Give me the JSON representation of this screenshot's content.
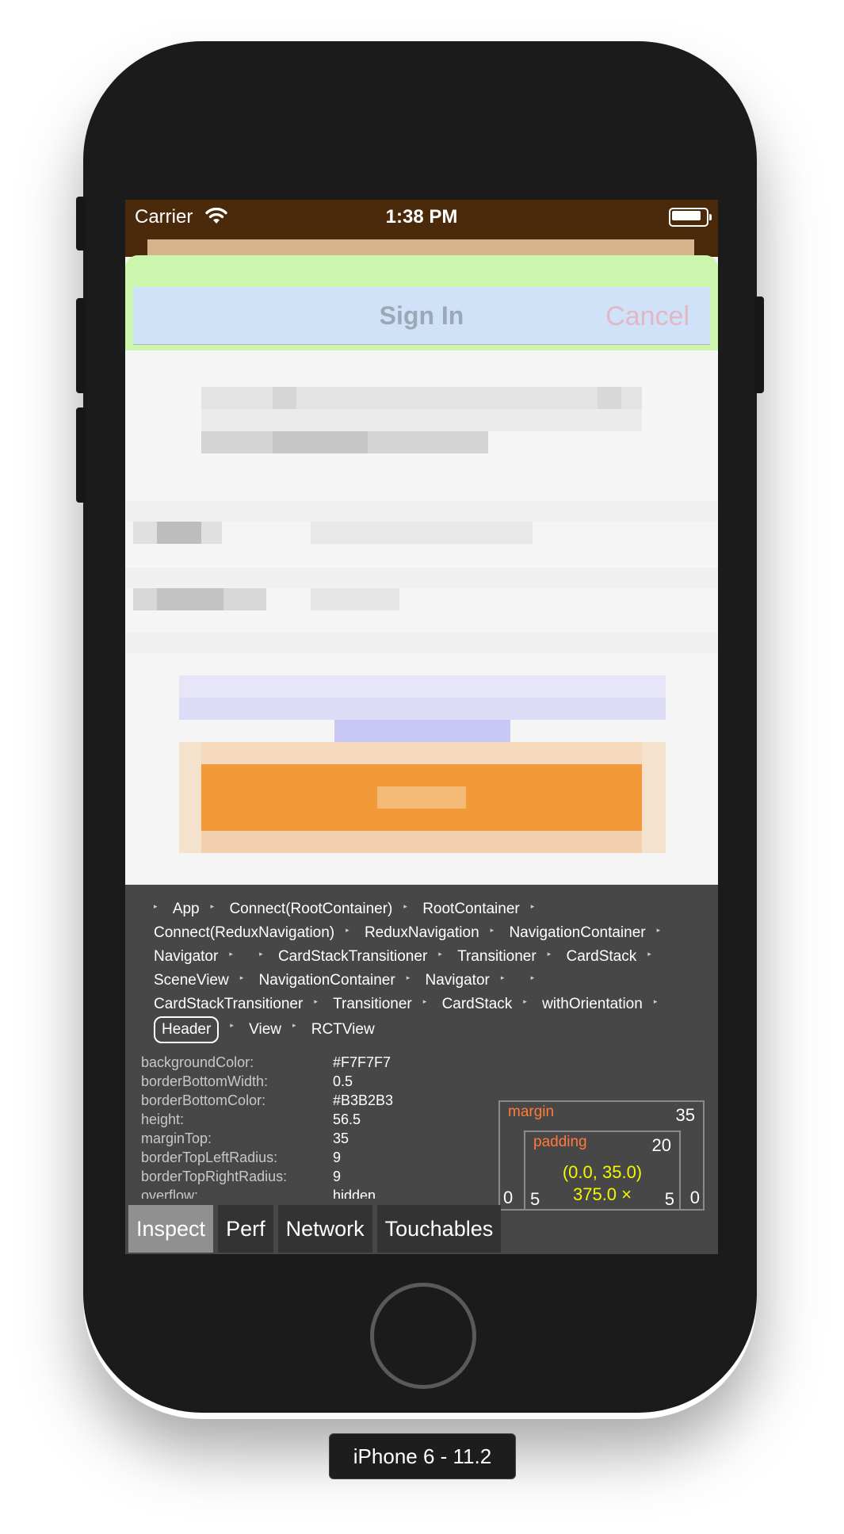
{
  "status_bar": {
    "carrier": "Carrier",
    "time": "1:38 PM"
  },
  "header": {
    "title": "Sign In",
    "cancel_label": "Cancel",
    "background_color": "#D0E2F8"
  },
  "colors": {
    "orange_button": "#F29A39",
    "inspector_bg": "#474747",
    "status_bar_bg": "#4A2A0B",
    "margin_highlight": "#CCF5AD"
  },
  "inspector": {
    "breadcrumbs": [
      "App",
      "Connect(RootContainer)",
      "RootContainer",
      "Connect(ReduxNavigation)",
      "ReduxNavigation",
      "NavigationContainer",
      "Navigator",
      "",
      "CardStackTransitioner",
      "Transitioner",
      "CardStack",
      "SceneView",
      "NavigationContainer",
      "Navigator",
      "",
      "CardStackTransitioner",
      "Transitioner",
      "CardStack",
      "withOrientation",
      "Header",
      "View",
      "RCTView"
    ],
    "selected_crumb": "Header",
    "props": [
      {
        "name": "backgroundColor:",
        "value": "#F7F7F7"
      },
      {
        "name": "borderBottomWidth:",
        "value": "0.5"
      },
      {
        "name": "borderBottomColor:",
        "value": "#B3B2B3"
      },
      {
        "name": "height:",
        "value": "56.5"
      },
      {
        "name": "marginTop:",
        "value": "35"
      },
      {
        "name": "borderTopLeftRadius:",
        "value": "9"
      },
      {
        "name": "borderTopRightRadius:",
        "value": "9"
      },
      {
        "name": "overflow:",
        "value": "hidden"
      }
    ],
    "box_model": {
      "margin_label": "margin",
      "margin_top": "35",
      "padding_label": "padding",
      "padding_top": "20",
      "position": "(0.0, 35.0)",
      "size": "375.0 ×",
      "margin_left": "0",
      "padding_left": "5",
      "padding_right": "5",
      "margin_right": "0"
    },
    "tabs": [
      {
        "label": "Inspect",
        "active": true
      },
      {
        "label": "Perf",
        "active": false
      },
      {
        "label": "Network",
        "active": false
      },
      {
        "label": "Touchables",
        "active": false
      }
    ]
  },
  "device_label": "iPhone 6 - 11.2"
}
